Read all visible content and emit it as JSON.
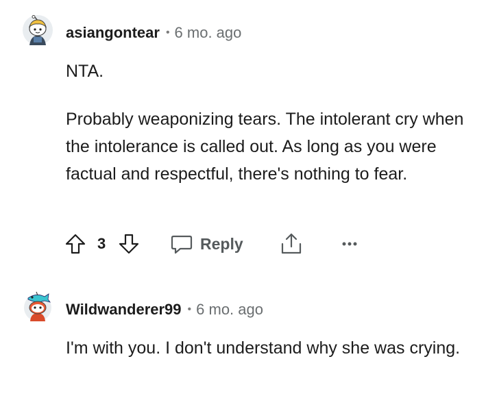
{
  "comments": [
    {
      "username": "asiangontear",
      "separator": "•",
      "time": "6 mo. ago",
      "paragraphs": [
        "NTA.",
        "Probably weaponizing tears. The intolerant cry when the intolerance is called out. As long as you were factual and respectful, there's nothing to fear."
      ],
      "score": "3",
      "reply_label": "Reply",
      "icons": {
        "avatar": "avatar-icon",
        "upvote": "upvote-arrow-icon",
        "downvote": "downvote-arrow-icon",
        "reply": "chat-bubble-icon",
        "share": "share-icon",
        "more": "more-dots-icon"
      }
    },
    {
      "username": "Wildwanderer99",
      "separator": "•",
      "time": "6 mo. ago",
      "paragraphs": [
        "I'm with you. I don't understand why she was crying."
      ],
      "icons": {
        "avatar": "avatar-icon"
      }
    }
  ],
  "colors": {
    "text": "#1c1c1c",
    "meta": "#6a6e70",
    "action": "#555a5c",
    "avatar_bg": "#e9edf0"
  }
}
